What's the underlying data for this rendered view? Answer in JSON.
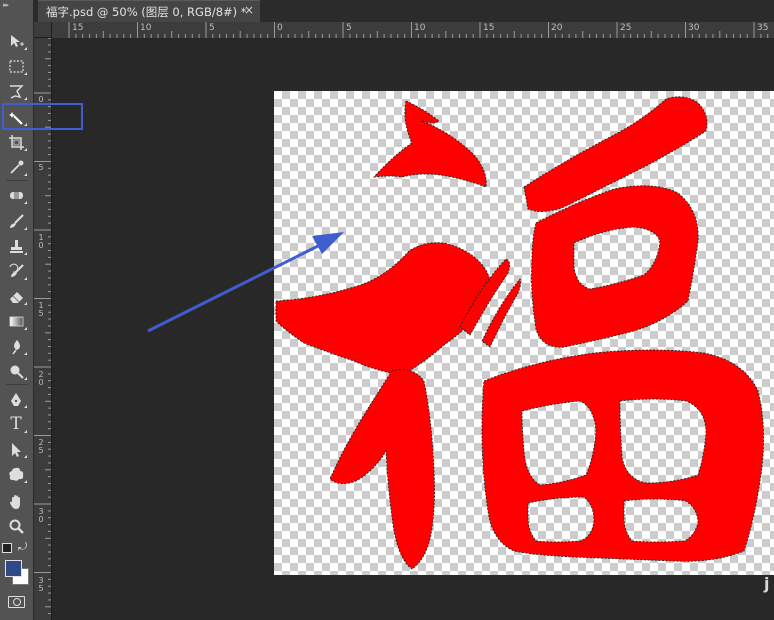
{
  "document": {
    "tab_title": "福字.psd @ 50% (图层 0, RGB/8#) *",
    "tab_close": "×"
  },
  "rulers": {
    "top_ticks": [
      "15",
      "10",
      "5",
      "0",
      "5",
      "10",
      "15",
      "20",
      "25",
      "30",
      "35"
    ],
    "left_ticks": [
      "0",
      "5",
      "10",
      "15",
      "20",
      "25",
      "30",
      "35"
    ]
  },
  "tools": [
    {
      "name": "move-tool",
      "icon": "move-icon"
    },
    {
      "name": "rectangular-marquee-tool",
      "icon": "marquee-icon"
    },
    {
      "name": "lasso-tool",
      "icon": "lasso-icon"
    },
    {
      "name": "magic-wand-tool",
      "icon": "magic-wand-icon",
      "selected": true
    },
    {
      "name": "crop-tool",
      "icon": "crop-icon"
    },
    {
      "name": "eyedropper-tool",
      "icon": "eyedropper-icon"
    },
    {
      "name": "spot-healing-tool",
      "icon": "healing-icon"
    },
    {
      "name": "brush-tool",
      "icon": "brush-icon"
    },
    {
      "name": "clone-stamp-tool",
      "icon": "stamp-icon"
    },
    {
      "name": "history-brush-tool",
      "icon": "history-brush-icon"
    },
    {
      "name": "eraser-tool",
      "icon": "eraser-icon"
    },
    {
      "name": "gradient-tool",
      "icon": "gradient-icon"
    },
    {
      "name": "blur-tool",
      "icon": "blur-icon"
    },
    {
      "name": "dodge-tool",
      "icon": "dodge-icon"
    },
    {
      "name": "pen-tool",
      "icon": "pen-icon"
    },
    {
      "name": "type-tool",
      "icon": "type-icon",
      "label": "T"
    },
    {
      "name": "path-selection-tool",
      "icon": "path-select-icon"
    },
    {
      "name": "custom-shape-tool",
      "icon": "shape-icon"
    },
    {
      "name": "hand-tool",
      "icon": "hand-icon"
    },
    {
      "name": "zoom-tool",
      "icon": "zoom-icon"
    }
  ],
  "colors": {
    "foreground": "#2e4a8a",
    "background": "#ffffff",
    "glyph": "#ff0000",
    "annotation": "#3f5fd0"
  },
  "canvas": {
    "zoom": "50%"
  },
  "watermark": "j"
}
